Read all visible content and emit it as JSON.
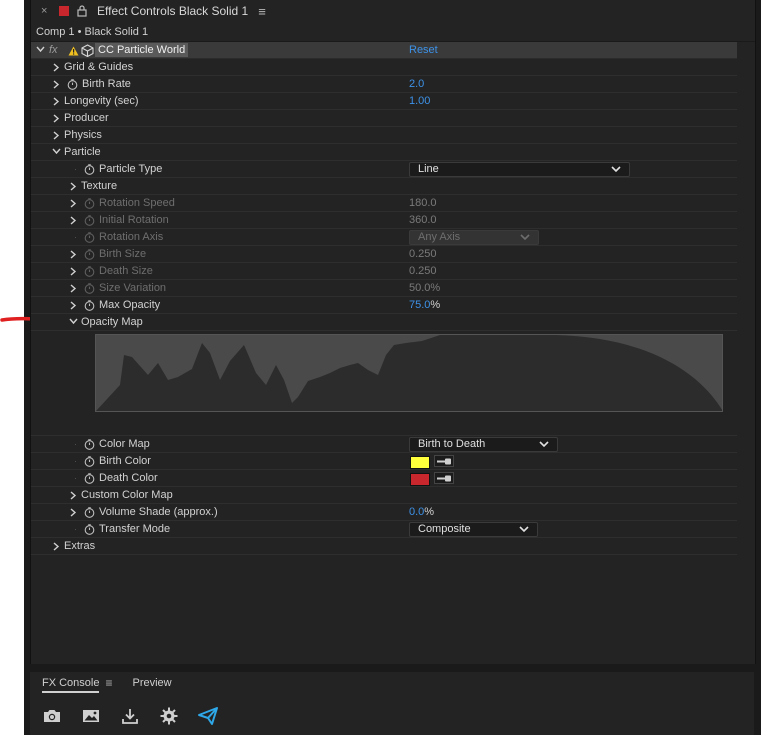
{
  "tab": {
    "close_glyph": "×",
    "title": "Effect Controls Black Solid 1",
    "menu_glyph": "≡",
    "color_label": "#c8272e"
  },
  "comp_header": "Comp 1 • Black Solid 1",
  "effect": {
    "fx_label": "fx",
    "name": "CC Particle World",
    "reset": "Reset"
  },
  "rows": {
    "grid_guides": "Grid & Guides",
    "birth_rate": {
      "label": "Birth Rate",
      "value": "2.0"
    },
    "longevity": {
      "label": "Longevity (sec)",
      "value": "1.00"
    },
    "producer": "Producer",
    "physics": "Physics",
    "particle": "Particle",
    "particle_type": {
      "label": "Particle Type",
      "value": "Line"
    },
    "texture": "Texture",
    "rotation_speed": {
      "label": "Rotation Speed",
      "value": "180.0"
    },
    "initial_rotation": {
      "label": "Initial Rotation",
      "value": "360.0"
    },
    "rotation_axis": {
      "label": "Rotation Axis",
      "value": "Any Axis"
    },
    "birth_size": {
      "label": "Birth Size",
      "value": "0.250"
    },
    "death_size": {
      "label": "Death Size",
      "value": "0.250"
    },
    "size_variation": {
      "label": "Size Variation",
      "value": "50.0",
      "unit": "%"
    },
    "max_opacity": {
      "label": "Max Opacity",
      "value": "75.0",
      "unit": "%"
    },
    "opacity_map": "Opacity Map",
    "color_map": {
      "label": "Color Map",
      "value": "Birth to Death"
    },
    "birth_color": {
      "label": "Birth Color",
      "color": "#ffff3c"
    },
    "death_color": {
      "label": "Death Color",
      "color": "#c8272e"
    },
    "custom_color_map": "Custom Color Map",
    "volume_shade": {
      "label": "Volume Shade (approx.)",
      "value": "0.0",
      "unit": "%"
    },
    "transfer_mode": {
      "label": "Transfer Mode",
      "value": "Composite"
    },
    "extras": "Extras"
  },
  "bottom": {
    "tabs": [
      "FX Console",
      "Preview"
    ],
    "menu_glyph": "≡",
    "tools": [
      "camera-icon",
      "image-icon",
      "download-icon",
      "gear-icon",
      "fx-console-logo-icon"
    ]
  },
  "colors": {
    "accent_blue": "#3d92e8",
    "annotation_arrow": "#e02020"
  }
}
